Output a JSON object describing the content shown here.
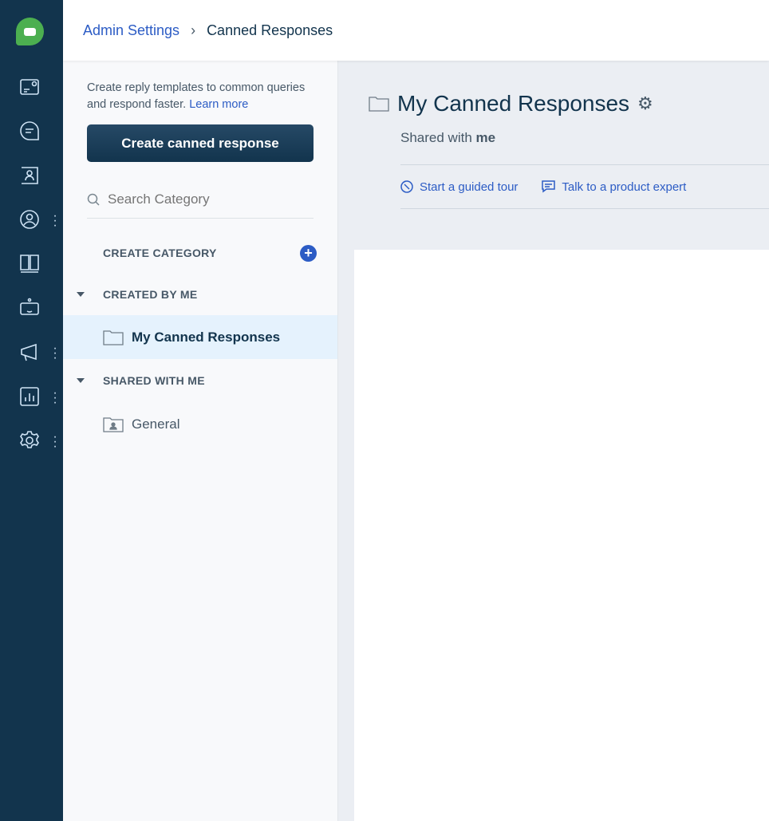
{
  "breadcrumb": {
    "parent": "Admin Settings",
    "current": "Canned Responses"
  },
  "sidebar": {
    "description": "Create reply templates to common queries and respond faster.",
    "learn_more": "Learn more",
    "create_button": "Create canned response",
    "search_placeholder": "Search Category",
    "create_category": "CREATE CATEGORY",
    "created_by_me": "CREATED BY ME",
    "shared_with_me": "SHARED WITH ME",
    "folders": {
      "mine": "My Canned Responses",
      "general": "General"
    }
  },
  "main": {
    "title": "My Canned Responses",
    "shared_prefix": "Shared with",
    "shared_who": "me",
    "guided_tour": "Start a guided tour",
    "talk_expert": "Talk to a product expert"
  },
  "colors": {
    "rail": "#12344d",
    "accent": "#2c5cc5",
    "logo": "#4caf50"
  }
}
